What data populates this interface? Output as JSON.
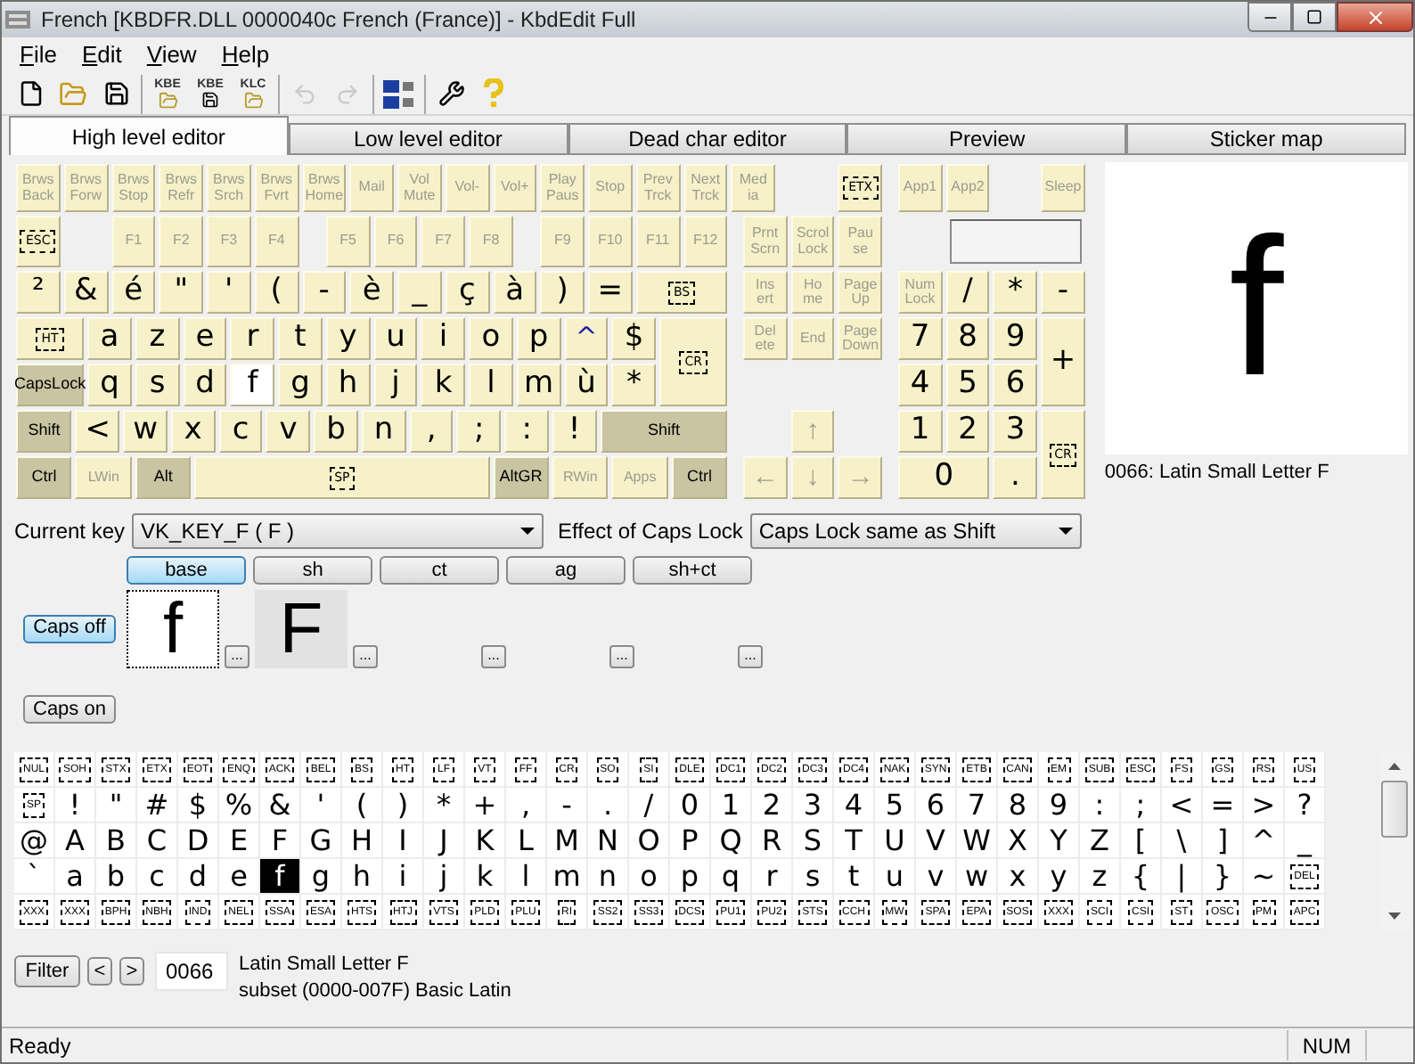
{
  "window": {
    "title": "French [KBDFR.DLL 0000040c French (France)] - KbdEdit Full"
  },
  "menu": [
    "File",
    "Edit",
    "View",
    "Help"
  ],
  "toolbar": [
    [
      {
        "kind": "new",
        "disabled": false
      },
      {
        "kind": "open",
        "disabled": false
      },
      {
        "kind": "save",
        "disabled": false
      }
    ],
    [
      {
        "kind": "kbe_open",
        "label": "KBE",
        "disabled": false
      },
      {
        "kind": "kbe_save",
        "label": "KBE",
        "disabled": false
      },
      {
        "kind": "klc_open",
        "label": "KLC",
        "disabled": false
      }
    ],
    [
      {
        "kind": "undo",
        "disabled": true
      },
      {
        "kind": "redo",
        "disabled": true
      }
    ],
    [
      {
        "kind": "language",
        "disabled": false
      }
    ],
    [
      {
        "kind": "tools",
        "disabled": false
      },
      {
        "kind": "help",
        "disabled": false
      }
    ]
  ],
  "tabs": [
    {
      "label": "High level editor",
      "selected": true
    },
    {
      "label": "Low level editor",
      "selected": false
    },
    {
      "label": "Dead char editor",
      "selected": false
    },
    {
      "label": "Preview",
      "selected": false
    },
    {
      "label": "Sticker map",
      "selected": false
    }
  ],
  "keyboard": {
    "keys": [
      {
        "label": "Brws Back",
        "kind": "dim",
        "selected": false
      },
      {
        "label": "Brws Forw",
        "kind": "dim",
        "selected": false
      },
      {
        "label": "Brws Stop",
        "kind": "dim",
        "selected": false
      },
      {
        "label": "Brws Refr",
        "kind": "dim",
        "selected": false
      },
      {
        "label": "Brws Srch",
        "kind": "dim",
        "selected": false
      },
      {
        "label": "Brws Fvrt",
        "kind": "dim",
        "selected": false
      },
      {
        "label": "Brws Home",
        "kind": "dim",
        "selected": false
      },
      {
        "label": "Mail",
        "kind": "dim",
        "selected": false
      },
      {
        "label": "Vol Mute",
        "kind": "dim",
        "selected": false
      },
      {
        "label": "Vol-",
        "kind": "dim",
        "selected": false
      },
      {
        "label": "Vol+",
        "kind": "dim",
        "selected": false
      },
      {
        "label": "Play Paus",
        "kind": "dim",
        "selected": false
      },
      {
        "label": "Stop",
        "kind": "dim",
        "selected": false
      },
      {
        "label": "Prev Trck",
        "kind": "dim",
        "selected": false
      },
      {
        "label": "Next Trck",
        "kind": "dim",
        "selected": false
      },
      {
        "label": "Med ia",
        "kind": "dim",
        "selected": false
      },
      {
        "label": "ETX",
        "kind": "ctrl",
        "selected": false
      },
      {
        "label": "App1",
        "kind": "dim",
        "selected": false
      },
      {
        "label": "App2",
        "kind": "dim",
        "selected": false
      },
      {
        "label": "Sleep",
        "kind": "dim",
        "selected": false
      },
      {
        "label": "ESC",
        "kind": "ctrl",
        "selected": false
      },
      {
        "label": "F1",
        "kind": "dim",
        "selected": false
      },
      {
        "label": "F2",
        "kind": "dim",
        "selected": false
      },
      {
        "label": "F3",
        "kind": "dim",
        "selected": false
      },
      {
        "label": "F4",
        "kind": "dim",
        "selected": false
      },
      {
        "label": "F5",
        "kind": "dim",
        "selected": false
      },
      {
        "label": "F6",
        "kind": "dim",
        "selected": false
      },
      {
        "label": "F7",
        "kind": "dim",
        "selected": false
      },
      {
        "label": "F8",
        "kind": "dim",
        "selected": false
      },
      {
        "label": "F9",
        "kind": "dim",
        "selected": false
      },
      {
        "label": "F10",
        "kind": "dim",
        "selected": false
      },
      {
        "label": "F11",
        "kind": "dim",
        "selected": false
      },
      {
        "label": "F12",
        "kind": "dim",
        "selected": false
      },
      {
        "label": "Prnt Scrn",
        "kind": "dim",
        "selected": false
      },
      {
        "label": "Scrol Lock",
        "kind": "dim",
        "selected": false
      },
      {
        "label": "Pau se",
        "kind": "dim",
        "selected": false
      },
      {
        "label": "²",
        "kind": "char",
        "selected": false
      },
      {
        "label": "&",
        "kind": "char",
        "selected": false
      },
      {
        "label": "é",
        "kind": "char",
        "selected": false
      },
      {
        "label": "\"",
        "kind": "char",
        "selected": false
      },
      {
        "label": "'",
        "kind": "char",
        "selected": false
      },
      {
        "label": "(",
        "kind": "char",
        "selected": false
      },
      {
        "label": "-",
        "kind": "char",
        "selected": false
      },
      {
        "label": "è",
        "kind": "char",
        "selected": false
      },
      {
        "label": "_",
        "kind": "char",
        "selected": false
      },
      {
        "label": "ç",
        "kind": "char",
        "selected": false
      },
      {
        "label": "à",
        "kind": "char",
        "selected": false
      },
      {
        "label": ")",
        "kind": "char",
        "selected": false
      },
      {
        "label": "=",
        "kind": "char",
        "selected": false
      },
      {
        "label": "BS",
        "kind": "ctrl",
        "selected": false
      },
      {
        "label": "Ins ert",
        "kind": "dim",
        "selected": false
      },
      {
        "label": "Ho me",
        "kind": "dim",
        "selected": false
      },
      {
        "label": "Page Up",
        "kind": "dim",
        "selected": false
      },
      {
        "label": "Num Lock",
        "kind": "dim",
        "selected": false
      },
      {
        "label": "/",
        "kind": "char",
        "selected": false
      },
      {
        "label": "*",
        "kind": "char",
        "selected": false
      },
      {
        "label": "-",
        "kind": "char",
        "selected": false
      },
      {
        "label": "HT",
        "kind": "ctrl",
        "selected": false
      },
      {
        "label": "a",
        "kind": "char",
        "selected": false
      },
      {
        "label": "z",
        "kind": "char",
        "selected": false
      },
      {
        "label": "e",
        "kind": "char",
        "selected": false
      },
      {
        "label": "r",
        "kind": "char",
        "selected": false
      },
      {
        "label": "t",
        "kind": "char",
        "selected": false
      },
      {
        "label": "y",
        "kind": "char",
        "selected": false
      },
      {
        "label": "u",
        "kind": "char",
        "selected": false
      },
      {
        "label": "i",
        "kind": "char",
        "selected": false
      },
      {
        "label": "o",
        "kind": "char",
        "selected": false
      },
      {
        "label": "p",
        "kind": "char",
        "selected": false
      },
      {
        "label": "^",
        "kind": "dead",
        "selected": false
      },
      {
        "label": "$",
        "kind": "char",
        "selected": false
      },
      {
        "label": "CR",
        "kind": "ctrl",
        "selected": false
      },
      {
        "label": "Del ete",
        "kind": "dim",
        "selected": false
      },
      {
        "label": "End",
        "kind": "dim",
        "selected": false
      },
      {
        "label": "Page Down",
        "kind": "dim",
        "selected": false
      },
      {
        "label": "7",
        "kind": "char",
        "selected": false
      },
      {
        "label": "8",
        "kind": "char",
        "selected": false
      },
      {
        "label": "9",
        "kind": "char",
        "selected": false
      },
      {
        "label": "+",
        "kind": "char",
        "selected": false
      },
      {
        "label": "CapsLock",
        "kind": "mod",
        "selected": false
      },
      {
        "label": "q",
        "kind": "char",
        "selected": false
      },
      {
        "label": "s",
        "kind": "char",
        "selected": false
      },
      {
        "label": "d",
        "kind": "char",
        "selected": false
      },
      {
        "label": "f",
        "kind": "char",
        "selected": true
      },
      {
        "label": "g",
        "kind": "char",
        "selected": false
      },
      {
        "label": "h",
        "kind": "char",
        "selected": false
      },
      {
        "label": "j",
        "kind": "char",
        "selected": false
      },
      {
        "label": "k",
        "kind": "char",
        "selected": false
      },
      {
        "label": "l",
        "kind": "char",
        "selected": false
      },
      {
        "label": "m",
        "kind": "char",
        "selected": false
      },
      {
        "label": "ù",
        "kind": "char",
        "selected": false
      },
      {
        "label": "*",
        "kind": "char",
        "selected": false
      },
      {
        "label": "4",
        "kind": "char",
        "selected": false
      },
      {
        "label": "5",
        "kind": "char",
        "selected": false
      },
      {
        "label": "6",
        "kind": "char",
        "selected": false
      },
      {
        "label": "Shift",
        "kind": "mod",
        "selected": false
      },
      {
        "label": "<",
        "kind": "char",
        "selected": false
      },
      {
        "label": "w",
        "kind": "char",
        "selected": false
      },
      {
        "label": "x",
        "kind": "char",
        "selected": false
      },
      {
        "label": "c",
        "kind": "char",
        "selected": false
      },
      {
        "label": "v",
        "kind": "char",
        "selected": false
      },
      {
        "label": "b",
        "kind": "char",
        "selected": false
      },
      {
        "label": "n",
        "kind": "char",
        "selected": false
      },
      {
        "label": ",",
        "kind": "char",
        "selected": false
      },
      {
        "label": ";",
        "kind": "char",
        "selected": false
      },
      {
        "label": ":",
        "kind": "char",
        "selected": false
      },
      {
        "label": "!",
        "kind": "char",
        "selected": false
      },
      {
        "label": "Shift",
        "kind": "mod",
        "selected": false
      },
      {
        "label": "↑",
        "kind": "dimchar",
        "selected": false
      },
      {
        "label": "1",
        "kind": "char",
        "selected": false
      },
      {
        "label": "2",
        "kind": "char",
        "selected": false
      },
      {
        "label": "3",
        "kind": "char",
        "selected": false
      },
      {
        "label": "CR",
        "kind": "ctrl",
        "selected": false
      },
      {
        "label": "Ctrl",
        "kind": "mod",
        "selected": false
      },
      {
        "label": "LWin",
        "kind": "dim",
        "selected": false
      },
      {
        "label": "Alt",
        "kind": "mod",
        "selected": false
      },
      {
        "label": "SP",
        "kind": "ctrl",
        "selected": false
      },
      {
        "label": "AltGR",
        "kind": "mod",
        "selected": false
      },
      {
        "label": "RWin",
        "kind": "dim",
        "selected": false
      },
      {
        "label": "Apps",
        "kind": "dim",
        "selected": false
      },
      {
        "label": "Ctrl",
        "kind": "mod",
        "selected": false
      },
      {
        "label": "←",
        "kind": "dimchar",
        "selected": false
      },
      {
        "label": "↓",
        "kind": "dimchar",
        "selected": false
      },
      {
        "label": "→",
        "kind": "dimchar",
        "selected": false
      },
      {
        "label": "0",
        "kind": "char",
        "selected": false
      },
      {
        "label": ".",
        "kind": "char",
        "selected": false
      }
    ]
  },
  "preview": {
    "char": "f",
    "caption": "0066: Latin Small Letter F"
  },
  "current_key": {
    "label": "Current key",
    "value": "VK_KEY_F ( F )"
  },
  "caps_effect": {
    "label": "Effect of Caps Lock",
    "value": "Caps Lock same as Shift"
  },
  "shift_states": [
    {
      "label": "base",
      "selected": true
    },
    {
      "label": "sh",
      "selected": false
    },
    {
      "label": "ct",
      "selected": false
    },
    {
      "label": "ag",
      "selected": false
    },
    {
      "label": "sh+ct",
      "selected": false
    }
  ],
  "caps_buttons": [
    {
      "label": "Caps off",
      "selected": true
    },
    {
      "label": "Caps on",
      "selected": false
    }
  ],
  "slots": [
    {
      "char": "f",
      "selected": true,
      "more": "..."
    },
    {
      "char": "F",
      "selected": false,
      "more": "..."
    },
    {
      "selected": false,
      "more": "..."
    },
    {
      "selected": false,
      "more": "..."
    },
    {
      "selected": false,
      "more": "..."
    }
  ],
  "char_grid": [
    [
      {
        "text": "NUL",
        "kind": "ctrl",
        "selected": false
      },
      {
        "text": "SOH",
        "kind": "ctrl",
        "selected": false
      },
      {
        "text": "STX",
        "kind": "ctrl",
        "selected": false
      },
      {
        "text": "ETX",
        "kind": "ctrl",
        "selected": false
      },
      {
        "text": "EOT",
        "kind": "ctrl",
        "selected": false
      },
      {
        "text": "ENQ",
        "kind": "ctrl",
        "selected": false
      },
      {
        "text": "ACK",
        "kind": "ctrl",
        "selected": false
      },
      {
        "text": "BEL",
        "kind": "ctrl",
        "selected": false
      },
      {
        "text": "BS",
        "kind": "ctrl",
        "selected": false
      },
      {
        "text": "HT",
        "kind": "ctrl",
        "selected": false
      },
      {
        "text": "LF",
        "kind": "ctrl",
        "selected": false
      },
      {
        "text": "VT",
        "kind": "ctrl",
        "selected": false
      },
      {
        "text": "FF",
        "kind": "ctrl",
        "selected": false
      },
      {
        "text": "CR",
        "kind": "ctrl",
        "selected": false
      },
      {
        "text": "SO",
        "kind": "ctrl",
        "selected": false
      },
      {
        "text": "SI",
        "kind": "ctrl",
        "selected": false
      },
      {
        "text": "DLE",
        "kind": "ctrl",
        "selected": false
      },
      {
        "text": "DC1",
        "kind": "ctrl",
        "selected": false
      },
      {
        "text": "DC2",
        "kind": "ctrl",
        "selected": false
      },
      {
        "text": "DC3",
        "kind": "ctrl",
        "selected": false
      },
      {
        "text": "DC4",
        "kind": "ctrl",
        "selected": false
      },
      {
        "text": "NAK",
        "kind": "ctrl",
        "selected": false
      },
      {
        "text": "SYN",
        "kind": "ctrl",
        "selected": false
      },
      {
        "text": "ETB",
        "kind": "ctrl",
        "selected": false
      },
      {
        "text": "CAN",
        "kind": "ctrl",
        "selected": false
      },
      {
        "text": "EM",
        "kind": "ctrl",
        "selected": false
      },
      {
        "text": "SUB",
        "kind": "ctrl",
        "selected": false
      },
      {
        "text": "ESC",
        "kind": "ctrl",
        "selected": false
      },
      {
        "text": "FS",
        "kind": "ctrl",
        "selected": false
      },
      {
        "text": "GS",
        "kind": "ctrl",
        "selected": false
      },
      {
        "text": "RS",
        "kind": "ctrl",
        "selected": false
      },
      {
        "text": "US",
        "kind": "ctrl",
        "selected": false
      }
    ],
    [
      {
        "text": "SP",
        "kind": "ctrl",
        "selected": false
      },
      {
        "text": "!",
        "kind": "char",
        "selected": false
      },
      {
        "text": "\"",
        "kind": "char",
        "selected": false
      },
      {
        "text": "#",
        "kind": "char",
        "selected": false
      },
      {
        "text": "$",
        "kind": "char",
        "selected": false
      },
      {
        "text": "%",
        "kind": "char",
        "selected": false
      },
      {
        "text": "&",
        "kind": "char",
        "selected": false
      },
      {
        "text": "'",
        "kind": "char",
        "selected": false
      },
      {
        "text": "(",
        "kind": "char",
        "selected": false
      },
      {
        "text": ")",
        "kind": "char",
        "selected": false
      },
      {
        "text": "*",
        "kind": "char",
        "selected": false
      },
      {
        "text": "+",
        "kind": "char",
        "selected": false
      },
      {
        "text": ",",
        "kind": "char",
        "selected": false
      },
      {
        "text": "-",
        "kind": "char",
        "selected": false
      },
      {
        "text": ".",
        "kind": "char",
        "selected": false
      },
      {
        "text": "/",
        "kind": "char",
        "selected": false
      },
      {
        "text": "0",
        "kind": "char",
        "selected": false
      },
      {
        "text": "1",
        "kind": "char",
        "selected": false
      },
      {
        "text": "2",
        "kind": "char",
        "selected": false
      },
      {
        "text": "3",
        "kind": "char",
        "selected": false
      },
      {
        "text": "4",
        "kind": "char",
        "selected": false
      },
      {
        "text": "5",
        "kind": "char",
        "selected": false
      },
      {
        "text": "6",
        "kind": "char",
        "selected": false
      },
      {
        "text": "7",
        "kind": "char",
        "selected": false
      },
      {
        "text": "8",
        "kind": "char",
        "selected": false
      },
      {
        "text": "9",
        "kind": "char",
        "selected": false
      },
      {
        "text": ":",
        "kind": "char",
        "selected": false
      },
      {
        "text": ";",
        "kind": "char",
        "selected": false
      },
      {
        "text": "<",
        "kind": "char",
        "selected": false
      },
      {
        "text": "=",
        "kind": "char",
        "selected": false
      },
      {
        "text": ">",
        "kind": "char",
        "selected": false
      },
      {
        "text": "?",
        "kind": "char",
        "selected": false
      }
    ],
    [
      {
        "text": "@",
        "kind": "char",
        "selected": false
      },
      {
        "text": "A",
        "kind": "char",
        "selected": false
      },
      {
        "text": "B",
        "kind": "char",
        "selected": false
      },
      {
        "text": "C",
        "kind": "char",
        "selected": false
      },
      {
        "text": "D",
        "kind": "char",
        "selected": false
      },
      {
        "text": "E",
        "kind": "char",
        "selected": false
      },
      {
        "text": "F",
        "kind": "char",
        "selected": false
      },
      {
        "text": "G",
        "kind": "char",
        "selected": false
      },
      {
        "text": "H",
        "kind": "char",
        "selected": false
      },
      {
        "text": "I",
        "kind": "char",
        "selected": false
      },
      {
        "text": "J",
        "kind": "char",
        "selected": false
      },
      {
        "text": "K",
        "kind": "char",
        "selected": false
      },
      {
        "text": "L",
        "kind": "char",
        "selected": false
      },
      {
        "text": "M",
        "kind": "char",
        "selected": false
      },
      {
        "text": "N",
        "kind": "char",
        "selected": false
      },
      {
        "text": "O",
        "kind": "char",
        "selected": false
      },
      {
        "text": "P",
        "kind": "char",
        "selected": false
      },
      {
        "text": "Q",
        "kind": "char",
        "selected": false
      },
      {
        "text": "R",
        "kind": "char",
        "selected": false
      },
      {
        "text": "S",
        "kind": "char",
        "selected": false
      },
      {
        "text": "T",
        "kind": "char",
        "selected": false
      },
      {
        "text": "U",
        "kind": "char",
        "selected": false
      },
      {
        "text": "V",
        "kind": "char",
        "selected": false
      },
      {
        "text": "W",
        "kind": "char",
        "selected": false
      },
      {
        "text": "X",
        "kind": "char",
        "selected": false
      },
      {
        "text": "Y",
        "kind": "char",
        "selected": false
      },
      {
        "text": "Z",
        "kind": "char",
        "selected": false
      },
      {
        "text": "[",
        "kind": "char",
        "selected": false
      },
      {
        "text": "\\",
        "kind": "char",
        "selected": false
      },
      {
        "text": "]",
        "kind": "char",
        "selected": false
      },
      {
        "text": "^",
        "kind": "char",
        "selected": false
      },
      {
        "text": "_",
        "kind": "char",
        "selected": false
      }
    ],
    [
      {
        "text": "`",
        "kind": "char",
        "selected": false
      },
      {
        "text": "a",
        "kind": "char",
        "selected": false
      },
      {
        "text": "b",
        "kind": "char",
        "selected": false
      },
      {
        "text": "c",
        "kind": "char",
        "selected": false
      },
      {
        "text": "d",
        "kind": "char",
        "selected": false
      },
      {
        "text": "e",
        "kind": "char",
        "selected": false
      },
      {
        "text": "f",
        "kind": "char",
        "selected": true
      },
      {
        "text": "g",
        "kind": "char",
        "selected": false
      },
      {
        "text": "h",
        "kind": "char",
        "selected": false
      },
      {
        "text": "i",
        "kind": "char",
        "selected": false
      },
      {
        "text": "j",
        "kind": "char",
        "selected": false
      },
      {
        "text": "k",
        "kind": "char",
        "selected": false
      },
      {
        "text": "l",
        "kind": "char",
        "selected": false
      },
      {
        "text": "m",
        "kind": "char",
        "selected": false
      },
      {
        "text": "n",
        "kind": "char",
        "selected": false
      },
      {
        "text": "o",
        "kind": "char",
        "selected": false
      },
      {
        "text": "p",
        "kind": "char",
        "selected": false
      },
      {
        "text": "q",
        "kind": "char",
        "selected": false
      },
      {
        "text": "r",
        "kind": "char",
        "selected": false
      },
      {
        "text": "s",
        "kind": "char",
        "selected": false
      },
      {
        "text": "t",
        "kind": "char",
        "selected": false
      },
      {
        "text": "u",
        "kind": "char",
        "selected": false
      },
      {
        "text": "v",
        "kind": "char",
        "selected": false
      },
      {
        "text": "w",
        "kind": "char",
        "selected": false
      },
      {
        "text": "x",
        "kind": "char",
        "selected": false
      },
      {
        "text": "y",
        "kind": "char",
        "selected": false
      },
      {
        "text": "z",
        "kind": "char",
        "selected": false
      },
      {
        "text": "{",
        "kind": "char",
        "selected": false
      },
      {
        "text": "|",
        "kind": "char",
        "selected": false
      },
      {
        "text": "}",
        "kind": "char",
        "selected": false
      },
      {
        "text": "~",
        "kind": "char",
        "selected": false
      },
      {
        "text": "DEL",
        "kind": "ctrl",
        "selected": false
      }
    ],
    [
      {
        "text": "XXX",
        "kind": "ctrl",
        "selected": false
      },
      {
        "text": "XXX",
        "kind": "ctrl",
        "selected": false
      },
      {
        "text": "BPH",
        "kind": "ctrl",
        "selected": false
      },
      {
        "text": "NBH",
        "kind": "ctrl",
        "selected": false
      },
      {
        "text": "IND",
        "kind": "ctrl",
        "selected": false
      },
      {
        "text": "NEL",
        "kind": "ctrl",
        "selected": false
      },
      {
        "text": "SSA",
        "kind": "ctrl",
        "selected": false
      },
      {
        "text": "ESA",
        "kind": "ctrl",
        "selected": false
      },
      {
        "text": "HTS",
        "kind": "ctrl",
        "selected": false
      },
      {
        "text": "HTJ",
        "kind": "ctrl",
        "selected": false
      },
      {
        "text": "VTS",
        "kind": "ctrl",
        "selected": false
      },
      {
        "text": "PLD",
        "kind": "ctrl",
        "selected": false
      },
      {
        "text": "PLU",
        "kind": "ctrl",
        "selected": false
      },
      {
        "text": "RI",
        "kind": "ctrl",
        "selected": false
      },
      {
        "text": "SS2",
        "kind": "ctrl",
        "selected": false
      },
      {
        "text": "SS3",
        "kind": "ctrl",
        "selected": false
      },
      {
        "text": "DCS",
        "kind": "ctrl",
        "selected": false
      },
      {
        "text": "PU1",
        "kind": "ctrl",
        "selected": false
      },
      {
        "text": "PU2",
        "kind": "ctrl",
        "selected": false
      },
      {
        "text": "STS",
        "kind": "ctrl",
        "selected": false
      },
      {
        "text": "CCH",
        "kind": "ctrl",
        "selected": false
      },
      {
        "text": "MW",
        "kind": "ctrl",
        "selected": false
      },
      {
        "text": "SPA",
        "kind": "ctrl",
        "selected": false
      },
      {
        "text": "EPA",
        "kind": "ctrl",
        "selected": false
      },
      {
        "text": "SOS",
        "kind": "ctrl",
        "selected": false
      },
      {
        "text": "XXX",
        "kind": "ctrl",
        "selected": false
      },
      {
        "text": "SCI",
        "kind": "ctrl",
        "selected": false
      },
      {
        "text": "CSI",
        "kind": "ctrl",
        "selected": false
      },
      {
        "text": "ST",
        "kind": "ctrl",
        "selected": false
      },
      {
        "text": "OSC",
        "kind": "ctrl",
        "selected": false
      },
      {
        "text": "PM",
        "kind": "ctrl",
        "selected": false
      },
      {
        "text": "APC",
        "kind": "ctrl",
        "selected": false
      }
    ]
  ],
  "filter": {
    "button": "Filter",
    "prev": "<",
    "next": ">",
    "code": "0066",
    "name": "Latin Small Letter F",
    "subset": "subset (0000-007F) Basic Latin"
  },
  "status_bar": {
    "text": "Ready",
    "num": "NUM"
  }
}
